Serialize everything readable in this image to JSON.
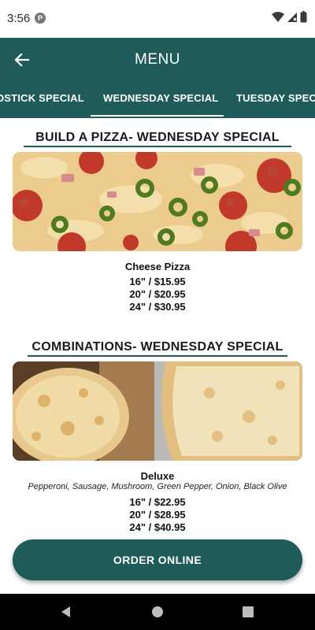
{
  "status_bar": {
    "time": "3:56",
    "notification_glyph": "P"
  },
  "app_bar": {
    "title": "MENU",
    "back_icon": "arrow-back-icon"
  },
  "tabs": [
    {
      "label": "OSTICK SPECIAL",
      "active": false
    },
    {
      "label": "WEDNESDAY SPECIAL",
      "active": true
    },
    {
      "label": "TUESDAY SPECI",
      "active": false
    }
  ],
  "sections": [
    {
      "title": "BUILD A PIZZA- WEDNESDAY SPECIAL",
      "item": {
        "name": "Cheese Pizza",
        "description": "",
        "prices": [
          "16\" / $15.95",
          "20\" / $20.95",
          "24\" / $30.95"
        ]
      }
    },
    {
      "title": "COMBINATIONS- WEDNESDAY SPECIAL",
      "item": {
        "name": "Deluxe",
        "description": "Pepperoni, Sausage, Mushroom, Green Pepper, Onion, Black Olive",
        "prices": [
          "16\" / $22.95",
          "20\" / $28.95",
          "24\" / $40.95"
        ]
      }
    }
  ],
  "order_button": {
    "label": "ORDER ONLINE"
  },
  "colors": {
    "primary": "#1f5b59",
    "text": "#111111"
  }
}
